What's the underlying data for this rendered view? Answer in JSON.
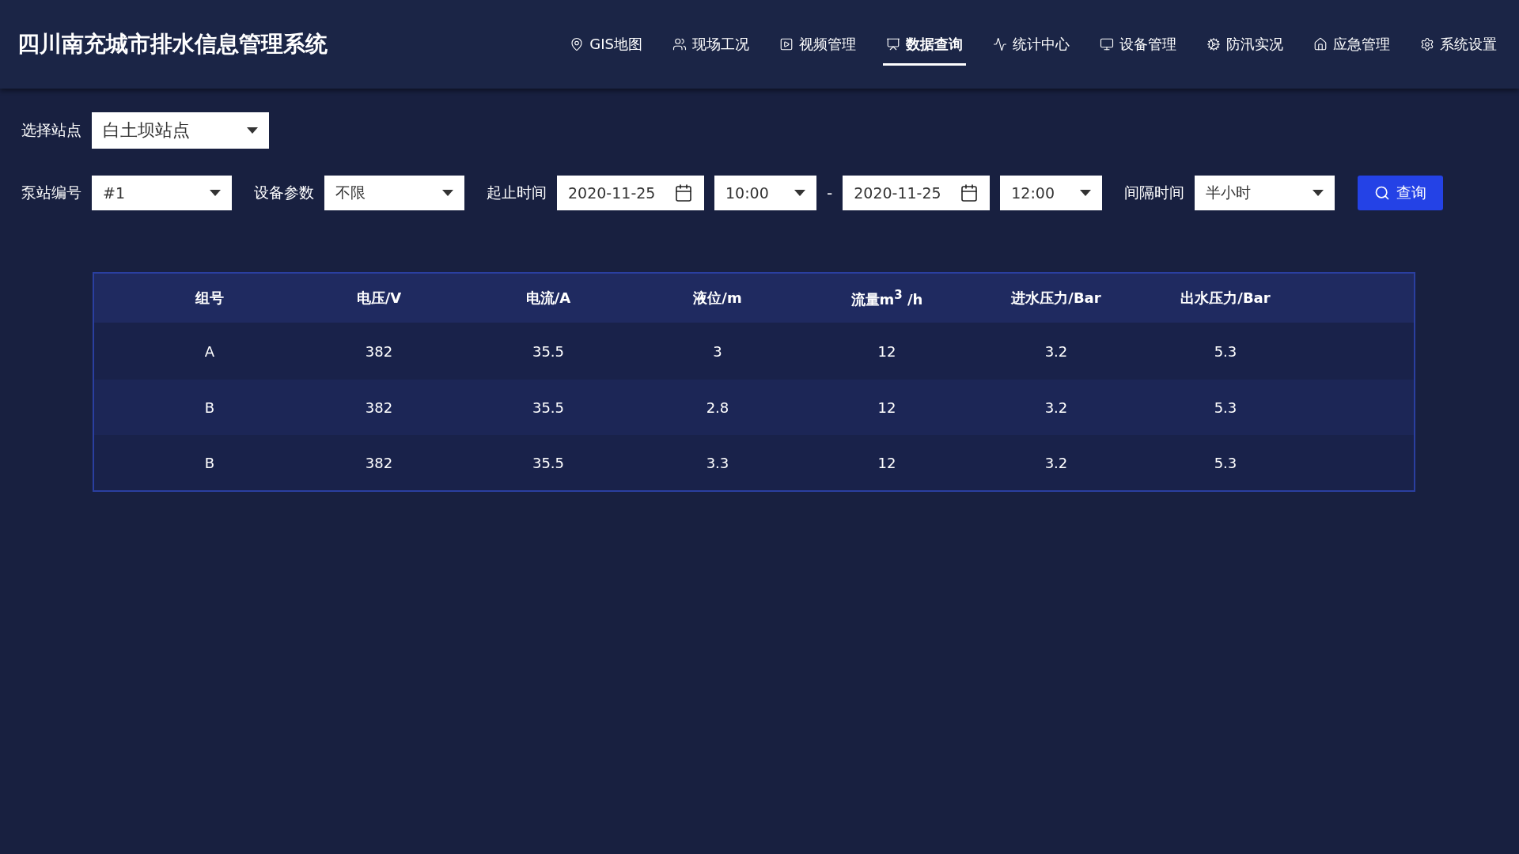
{
  "header": {
    "title": "四川南充城市排水信息管理系统"
  },
  "nav": [
    {
      "label": "GIS地图",
      "selected": false
    },
    {
      "label": "现场工况",
      "selected": false
    },
    {
      "label": "视频管理",
      "selected": false
    },
    {
      "label": "数据查询",
      "selected": true
    },
    {
      "label": "统计中心",
      "selected": false
    },
    {
      "label": "设备管理",
      "selected": false
    },
    {
      "label": "防汛实况",
      "selected": false
    },
    {
      "label": "应急管理",
      "selected": false
    },
    {
      "label": "系统设置",
      "selected": false
    }
  ],
  "station": {
    "label": "选择站点",
    "value": "白土坝站点"
  },
  "filters": [
    {
      "kind": "label",
      "text": "泵站编号"
    },
    {
      "kind": "select",
      "value": "#1"
    },
    {
      "kind": "label",
      "text": "设备参数"
    },
    {
      "kind": "select",
      "value": "不限"
    },
    {
      "kind": "label",
      "text": "起止时间"
    },
    {
      "kind": "date",
      "value": "2020-11-25"
    },
    {
      "kind": "time",
      "value": "10:00"
    },
    {
      "kind": "separator",
      "text": "-"
    },
    {
      "kind": "date",
      "value": "2020-11-25"
    },
    {
      "kind": "time",
      "value": "12:00"
    },
    {
      "kind": "label",
      "text": "间隔时间"
    },
    {
      "kind": "select",
      "value": "半小时"
    }
  ],
  "query_button": {
    "label": "查询"
  },
  "table": {
    "columns": [
      "组号",
      "电压/V",
      "电流/A",
      "液位/m",
      "流量m$^{3}$ /h",
      "进水压力/Bar",
      "出水压力/Bar"
    ],
    "rows": [
      [
        "A",
        "382",
        "35.5",
        "3",
        "12",
        "3.2",
        "5.3"
      ],
      [
        "B",
        "382",
        "35.5",
        "2.8",
        "12",
        "3.2",
        "5.3"
      ],
      [
        "B",
        "382",
        "35.5",
        "3.3",
        "12",
        "3.2",
        "5.3"
      ]
    ]
  }
}
